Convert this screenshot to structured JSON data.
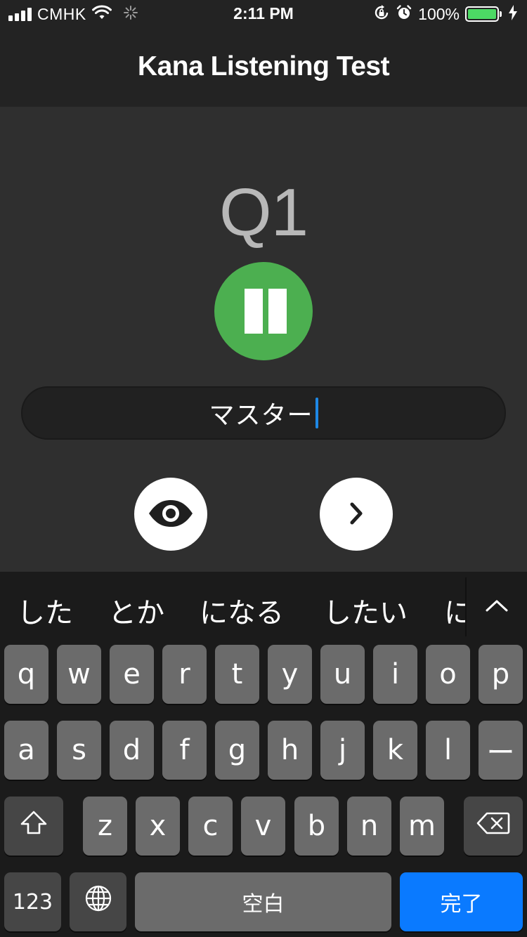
{
  "status_bar": {
    "carrier": "CMHK",
    "time": "2:11 PM",
    "battery_percent": "100%",
    "battery_level": 1.0,
    "icons": [
      "signal-icon",
      "wifi-icon",
      "activity-spinner-icon",
      "orientation-lock-icon",
      "alarm-icon",
      "battery-icon",
      "charging-bolt-icon"
    ]
  },
  "nav": {
    "title": "Kana Listening Test"
  },
  "question": {
    "label": "Q1"
  },
  "player": {
    "state": "playing",
    "icon": "pause-icon",
    "color": "#4caf50"
  },
  "answer": {
    "value": "マスター",
    "caret_color": "#1e88e5"
  },
  "actions": {
    "reveal_icon": "eye-icon",
    "next_icon": "chevron-right-icon"
  },
  "keyboard": {
    "suggestions": [
      "した",
      "とか",
      "になる",
      "したい",
      "に"
    ],
    "collapse_icon": "chevron-up-icon",
    "row1": [
      "q",
      "w",
      "e",
      "r",
      "t",
      "y",
      "u",
      "i",
      "o",
      "p"
    ],
    "row2": [
      "a",
      "s",
      "d",
      "f",
      "g",
      "h",
      "j",
      "k",
      "l",
      "ー"
    ],
    "row3": [
      "z",
      "x",
      "c",
      "v",
      "b",
      "n",
      "m"
    ],
    "shift_icon": "shift-icon",
    "delete_icon": "backspace-icon",
    "numbers_label": "123",
    "globe_icon": "globe-icon",
    "space_label": "空白",
    "done_label": "完了",
    "accent_color": "#0a7aff"
  }
}
